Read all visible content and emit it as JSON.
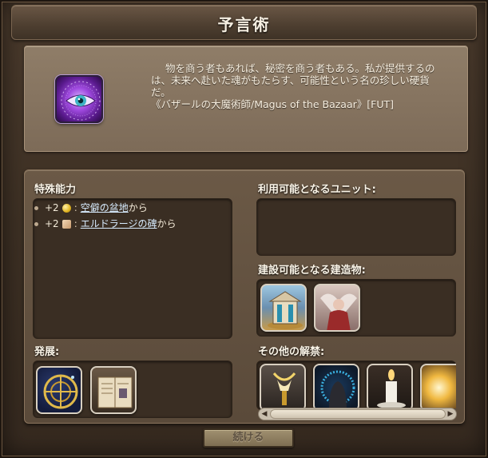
{
  "window": {
    "title": "予言術"
  },
  "lore": {
    "icon": "all-seeing-eye-icon",
    "line1": "物を商う者もあれば、秘密を商う者もある。私が提供するの",
    "line2": "は、未来へ赴いた魂がもたらす、可能性という名の珍しい硬貨",
    "line3": "だ。",
    "line4": "《バザールの大魔術師/Magus of the Bazaar》[FUT]"
  },
  "special_abilities": {
    "label": "特殊能力",
    "items": [
      {
        "amount": "+2",
        "icon": "gold-coin-icon",
        "link": "空僻の盆地",
        "suffix": "から"
      },
      {
        "amount": "+2",
        "icon": "scroll-icon",
        "link": "エルドラージの碑",
        "suffix": "から"
      }
    ]
  },
  "units": {
    "label": "利用可能となるユニット:"
  },
  "buildings": {
    "label": "建設可能となる建造物:",
    "items": [
      "shrine-building-icon",
      "weeping-angel-icon"
    ]
  },
  "developments": {
    "label": "発展:",
    "items": [
      "astrolabe-icon",
      "spellbook-icon"
    ]
  },
  "other_unlocks": {
    "label": "その他の解禁:",
    "items": [
      "golden-chalice-icon",
      "hooded-figure-icon",
      "candle-icon",
      "radiant-orb-icon"
    ]
  },
  "buttons": {
    "continue": "続ける"
  }
}
